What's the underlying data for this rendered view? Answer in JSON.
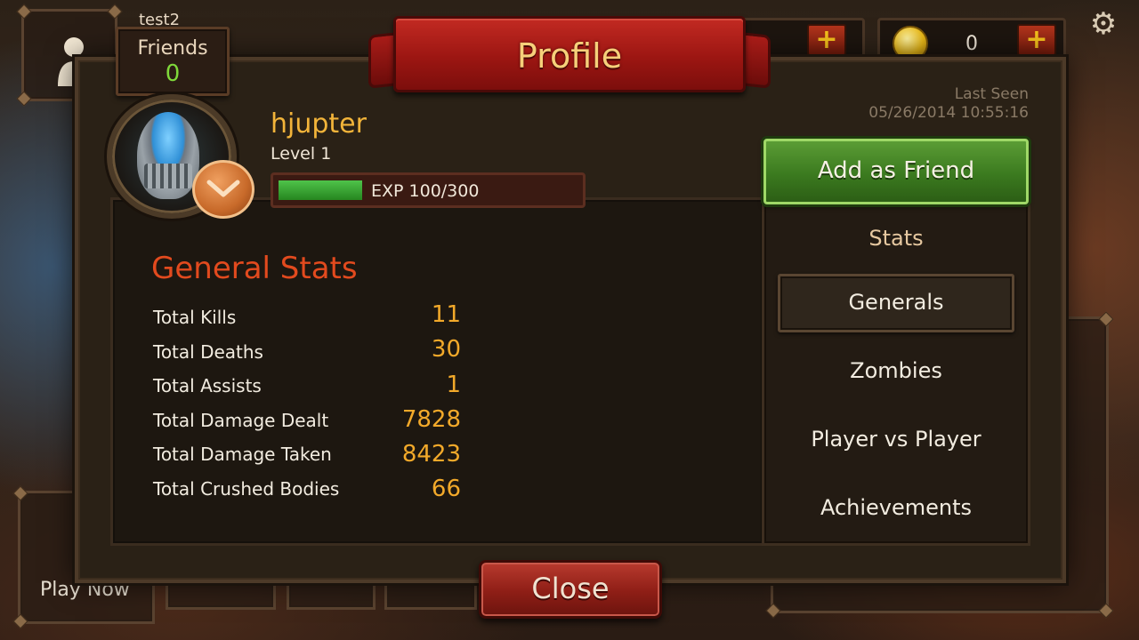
{
  "background": {
    "top_left_name": "test2",
    "coins_value": "0",
    "plus_glyph": "+",
    "gear_glyph": "⚙",
    "play_now_label": "Play Now"
  },
  "dialog": {
    "title": "Profile",
    "friends_label": "Friends",
    "friends_count": "0",
    "player": {
      "name": "hjupter",
      "level": "Level 1",
      "exp_text": "EXP 100/300",
      "exp_fraction": 0.333
    },
    "last_seen": {
      "label": "Last Seen",
      "value": "05/26/2014 10:55:16"
    },
    "add_friend_label": "Add as Friend",
    "stats_heading": "Stats",
    "menu": [
      "Generals",
      "Zombies",
      "Player vs Player",
      "Achievements"
    ],
    "selected_menu": "Generals",
    "general_stats_title": "General Stats",
    "stats": [
      {
        "label": "Total Kills",
        "value": "11"
      },
      {
        "label": "Total Deaths",
        "value": "30"
      },
      {
        "label": "Total Assists",
        "value": "1"
      },
      {
        "label": "Total Damage Dealt",
        "value": "7828"
      },
      {
        "label": "Total Damage Taken",
        "value": "8423"
      },
      {
        "label": "Total Crushed Bodies",
        "value": "66"
      }
    ],
    "close_label": "Close"
  },
  "colors": {
    "accent_gold": "#f2a92a",
    "player_name": "#f2b43a",
    "stats_title": "#e24a1e",
    "friends_count": "#7fd83a",
    "button_green": "#3b7a1f",
    "button_red": "#8e1e16"
  },
  "icons": [
    "user-silhouette-icon",
    "gem-icon",
    "coin-icon",
    "plus-icon",
    "gear-icon",
    "knight-helmet-avatar",
    "rank-chevron-icon"
  ]
}
